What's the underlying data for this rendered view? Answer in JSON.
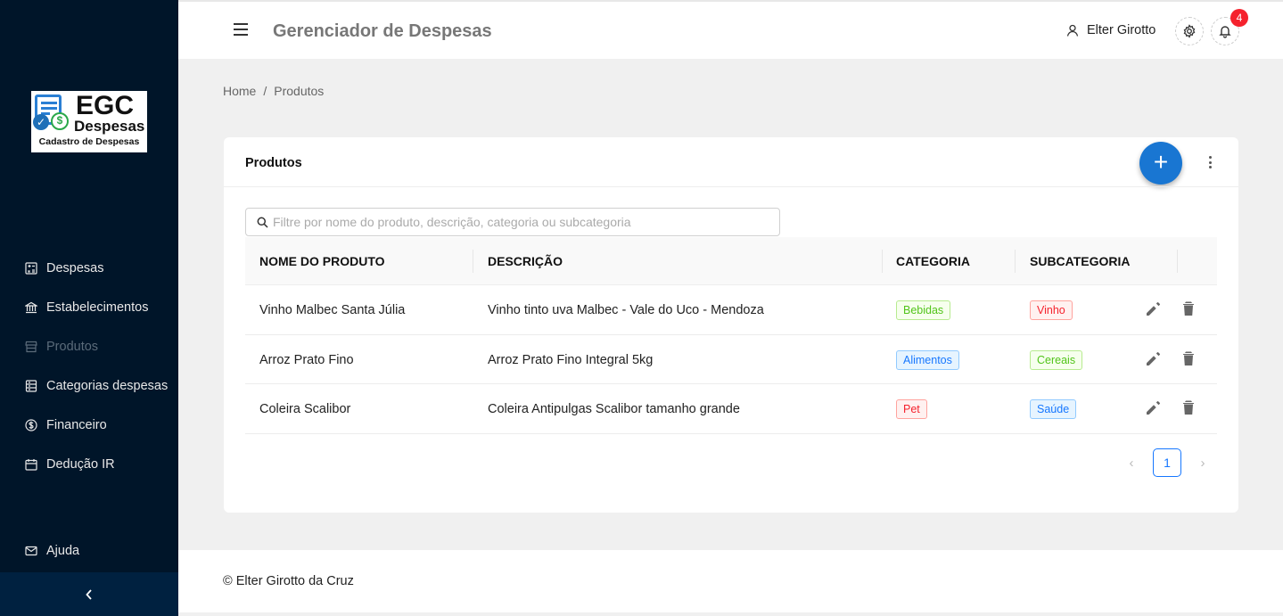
{
  "sidebar": {
    "logo": {
      "title": "EGC",
      "subtitle": "Despesas",
      "tagline": "Cadastro de Despesas"
    },
    "items": [
      {
        "label": "Despesas",
        "icon": "calculator-icon",
        "active": false
      },
      {
        "label": "Estabelecimentos",
        "icon": "bank-icon",
        "active": false
      },
      {
        "label": "Produtos",
        "icon": "shop-icon",
        "active": true
      },
      {
        "label": "Categorias despesas",
        "icon": "container-icon",
        "active": false
      },
      {
        "label": "Financeiro",
        "icon": "dollar-icon",
        "active": false
      },
      {
        "label": "Dedução IR",
        "icon": "calendar-icon",
        "active": false
      }
    ],
    "help": {
      "label": "Ajuda",
      "icon": "mail-icon"
    },
    "collapse_icon": "chevron-left-icon",
    "colors": {
      "background": "#001529",
      "collapse_bar": "#002140"
    }
  },
  "header": {
    "title": "Gerenciador de Despesas",
    "user_name": "Elter Girotto",
    "notification_count": "4"
  },
  "breadcrumb": {
    "home": "Home",
    "separator": "/",
    "current": "Produtos"
  },
  "card": {
    "title": "Produtos",
    "add_button": "+",
    "search_placeholder": "Filtre por nome do produto, descrição, categoria ou subcategoria",
    "columns": [
      "NOME DO PRODUTO",
      "DESCRIÇÃO",
      "CATEGORIA",
      "SUBCATEGORIA"
    ],
    "rows": [
      {
        "name": "Vinho Malbec Santa Júlia",
        "description": "Vinho tinto uva Malbec - Vale do Uco - Mendoza",
        "category": "Bebidas",
        "category_color": "green",
        "subcategory": "Vinho",
        "subcategory_color": "red"
      },
      {
        "name": "Arroz Prato Fino",
        "description": "Arroz Prato Fino Integral 5kg",
        "category": "Alimentos",
        "category_color": "blue",
        "subcategory": "Cereais",
        "subcategory_color": "green"
      },
      {
        "name": "Coleira Scalibor",
        "description": "Coleira Antipulgas Scalibor tamanho grande",
        "category": "Pet",
        "category_color": "red",
        "subcategory": "Saúde",
        "subcategory_color": "blue"
      }
    ],
    "pagination": {
      "prev": "‹",
      "current_page": "1",
      "next": "›"
    }
  },
  "footer": {
    "text": "© Elter Girotto da Cruz"
  },
  "colors": {
    "accent": "#1976d2",
    "badge": "#f5222d",
    "tag_green": "#52c41a",
    "tag_blue": "#1677ff",
    "tag_red": "#f5222d"
  }
}
